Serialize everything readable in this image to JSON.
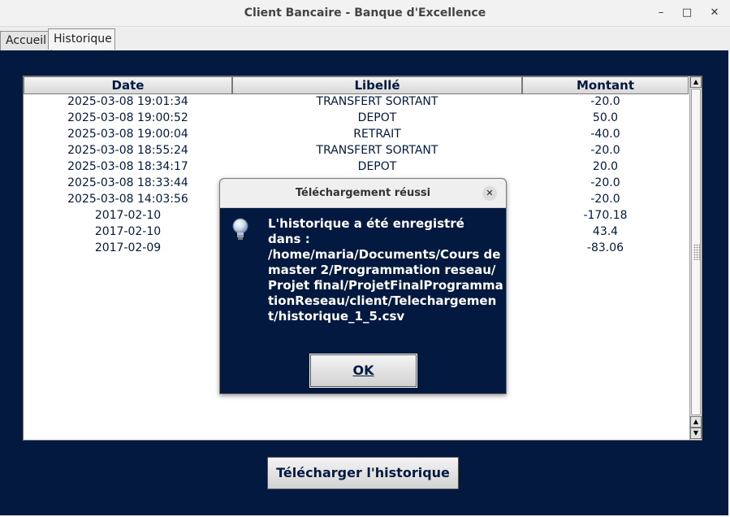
{
  "window": {
    "title": "Client Bancaire - Banque d'Excellence",
    "min_icon": "minimize-icon",
    "max_icon": "maximize-icon",
    "close_icon": "close-icon"
  },
  "tabs": [
    {
      "label": "Accueil"
    },
    {
      "label": "Historique",
      "selected": true
    }
  ],
  "table": {
    "columns": [
      "Date",
      "Libellé",
      "Montant"
    ],
    "rows": [
      {
        "date": "2025-03-08 19:01:34",
        "libelle": "TRANSFERT SORTANT",
        "montant": "-20.0"
      },
      {
        "date": "2025-03-08 19:00:52",
        "libelle": "DEPOT",
        "montant": "50.0"
      },
      {
        "date": "2025-03-08 19:00:04",
        "libelle": "RETRAIT",
        "montant": "-40.0"
      },
      {
        "date": "2025-03-08 18:55:24",
        "libelle": "TRANSFERT SORTANT",
        "montant": "-20.0"
      },
      {
        "date": "2025-03-08 18:34:17",
        "libelle": "DEPOT",
        "montant": "20.0"
      },
      {
        "date": "2025-03-08 18:33:44",
        "libelle": "",
        "montant": "-20.0"
      },
      {
        "date": "2025-03-08 14:03:56",
        "libelle": "",
        "montant": "-20.0"
      },
      {
        "date": "2017-02-10",
        "libelle": "",
        "montant": "-170.18"
      },
      {
        "date": "2017-02-10",
        "libelle": "",
        "montant": "43.4"
      },
      {
        "date": "2017-02-09",
        "libelle": "",
        "montant": "-83.06"
      }
    ]
  },
  "download_button": {
    "label": "Télécharger l'historique"
  },
  "dialog": {
    "title": "Téléchargement réussi",
    "icon": "lightbulb-icon",
    "message": "L'historique a été enregistré\ndans :\n/home/maria/Documents/Cours de master 2/Programmation reseau/Projet final/ProjetFinalProgrammationReseau/client/Telechargement/historique_1_5.csv",
    "ok_label": "OK"
  },
  "colors": {
    "panel": "#03193f",
    "text": "#03193f"
  }
}
